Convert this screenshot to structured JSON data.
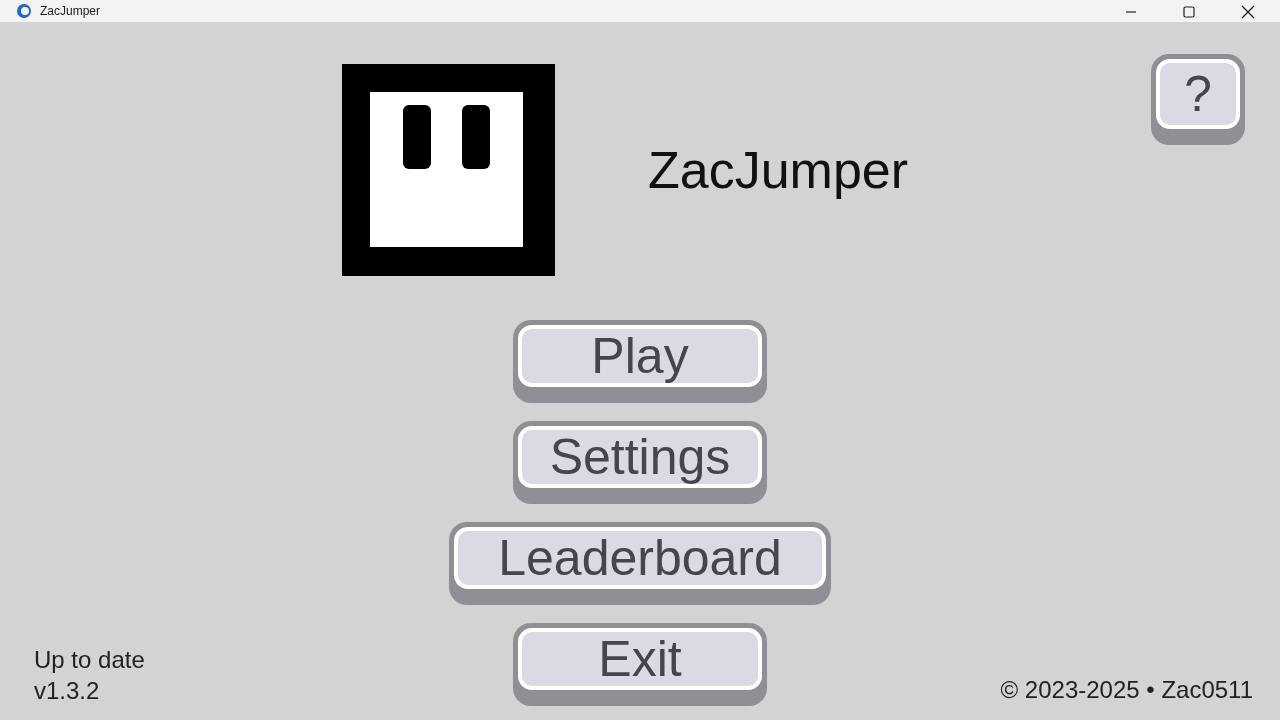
{
  "window": {
    "title": "ZacJumper"
  },
  "app_title": "ZacJumper",
  "help_button": {
    "label": "?"
  },
  "menu_buttons": [
    {
      "label": "Play",
      "kind": "normal"
    },
    {
      "label": "Settings",
      "kind": "normal"
    },
    {
      "label": "Leaderboard",
      "kind": "wide"
    },
    {
      "label": "Exit",
      "kind": "normal"
    }
  ],
  "update_status": "Up to date",
  "version": "v1.3.2",
  "copyright": "© 2023-2025 • Zac0511"
}
